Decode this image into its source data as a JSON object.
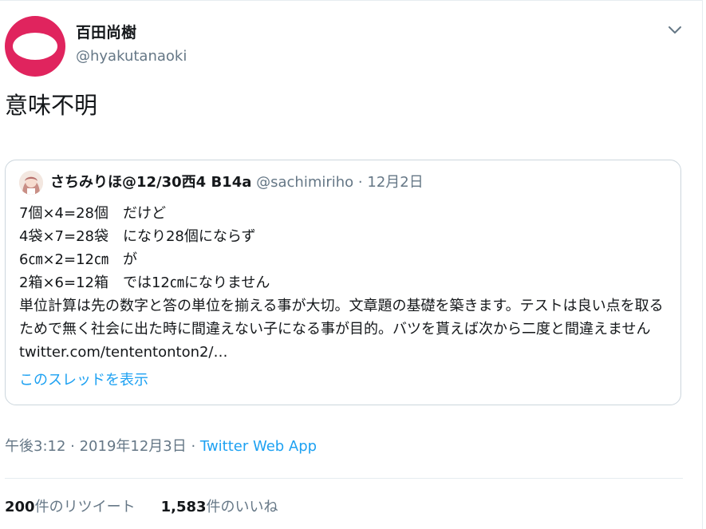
{
  "tweet": {
    "author_name": "百田尚樹",
    "author_handle": "@hyakutanaoki",
    "text": "意味不明",
    "timestamp": "午後3:12 · 2019年12月3日 · ",
    "via": "Twitter Web App",
    "retweets_count": "200",
    "retweets_label": "件のリツイート",
    "likes_count": "1,583",
    "likes_label": "件のいいね"
  },
  "quote": {
    "name": "さちみりほ@12/30西4 B14a",
    "handle": "@sachimiriho",
    "date": " · 12月2日",
    "lines": [
      "7個×4=28個　だけど",
      "4袋×7=28袋　になり28個にならず",
      "6㎝×2=12㎝　が",
      "2箱×6=12箱　では12㎝になりません"
    ],
    "paragraph": "単位計算は先の数字と答の単位を揃える事が大切。文章題の基礎を築きます。テストは良い点を取るためで無く社会に出た時に間違えない子になる事が目的。バツを貰えば次から二度と間違えません ",
    "link": "twitter.com/tententonton2/…",
    "show_thread": "このスレッドを表示"
  },
  "icons": {
    "caret": "chevron-down-icon",
    "avatar": "avatar",
    "quote_avatar": "quote-avatar"
  },
  "colors": {
    "link_blue": "#1da1f2",
    "secondary_text": "#657786",
    "avatar_red": "#e0245e",
    "border": "#ccd6dd"
  }
}
